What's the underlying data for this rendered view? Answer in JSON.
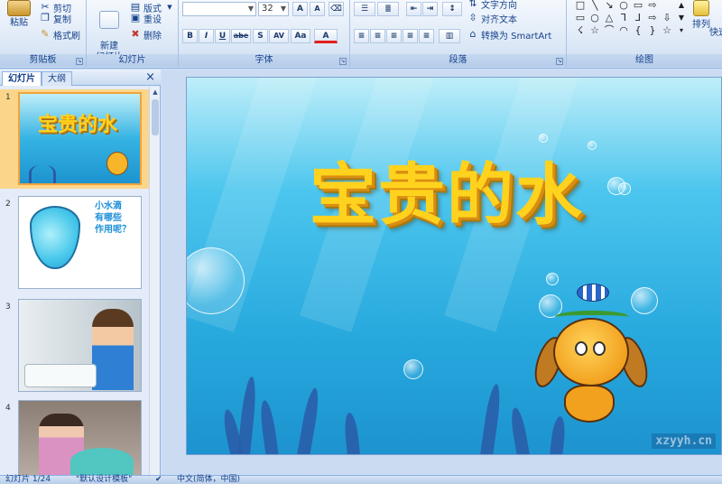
{
  "ribbon": {
    "clipboard": {
      "group_label": "剪贴板",
      "paste_label": "粘贴",
      "cut_label": "剪切",
      "copy_label": "复制",
      "format_painter_label": "格式刷"
    },
    "slides": {
      "group_label": "幻灯片",
      "new_slide_label": "新建\n幻灯片",
      "layout_label": "版式",
      "reset_label": "重设",
      "delete_label": "删除"
    },
    "font": {
      "group_label": "字体",
      "font_name": "",
      "font_size": "32",
      "bold": "B",
      "italic": "I",
      "underline": "U",
      "strike": "abe",
      "shadow": "S",
      "spacing": "AV",
      "case": "Aa",
      "color": "A",
      "grow": "A",
      "shrink": "A"
    },
    "paragraph": {
      "group_label": "段落",
      "text_direction_label": "文字方向",
      "align_text_label": "对齐文本",
      "smartart_label": "转换为 SmartArt"
    },
    "drawing": {
      "group_label": "绘图",
      "arrange_label": "排列",
      "quick_styles_label": "快速"
    }
  },
  "left_pane": {
    "tabs": [
      "幻灯片",
      "大纲"
    ],
    "close": "×",
    "thumbnails": [
      {
        "number": "1",
        "title": "宝贵的水",
        "selected": true
      },
      {
        "number": "2",
        "text": "小水滴\n有哪些\n作用呢？",
        "selected": false
      },
      {
        "number": "3",
        "selected": false
      },
      {
        "number": "4",
        "selected": false
      }
    ]
  },
  "slide": {
    "title": "宝贵的水",
    "watermark": "xzyyh.cn"
  },
  "status_bar": {
    "slide_counter": "幻灯片 1/24",
    "theme": "\"默认设计模板\"",
    "language": "中文(简体，中国)"
  },
  "colors": {
    "accent": "#15428b",
    "title_fill": "#ffd21e",
    "title_shadow": "#d98d12",
    "selected_thumb": "#fbd68a"
  }
}
